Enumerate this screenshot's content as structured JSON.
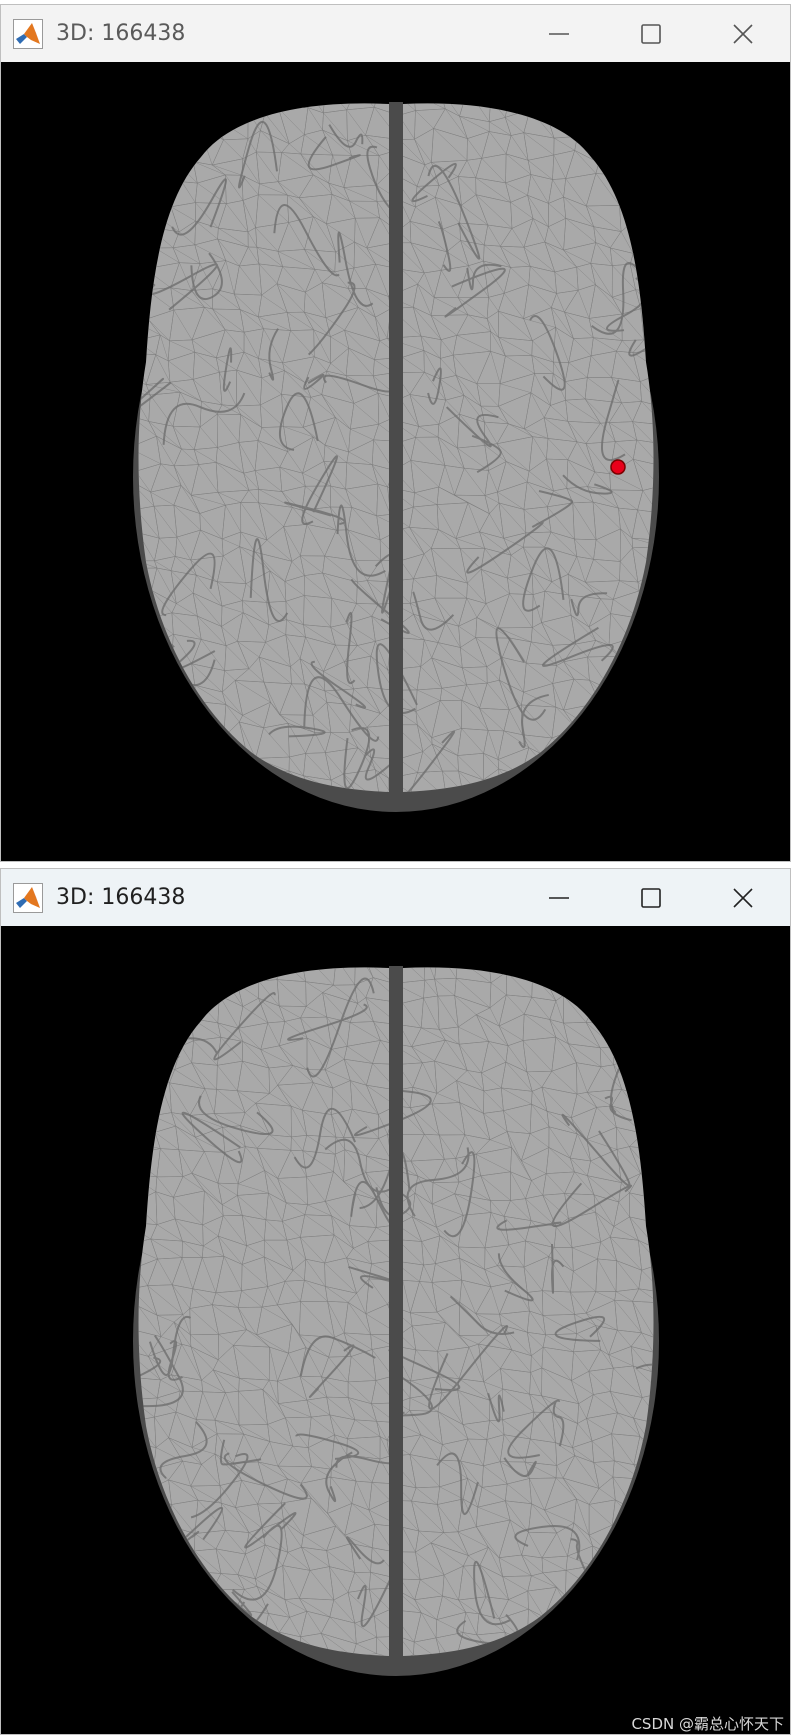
{
  "windows": [
    {
      "title": "3D: 166438",
      "icon": "matlab-icon",
      "controls": [
        "minimize-icon",
        "maximize-icon",
        "close-icon"
      ],
      "has_marker": true,
      "marker_color": "#e8001a"
    },
    {
      "title": "3D: 166438",
      "icon": "matlab-icon",
      "controls": [
        "minimize-icon",
        "maximize-icon",
        "close-icon"
      ],
      "has_marker": false
    }
  ],
  "colors": {
    "brain_fill": "#a9a9a9",
    "skull_fill": "#4b4b4b",
    "mesh_line": "#7b7b7b",
    "background": "#000000"
  },
  "watermark": "CSDN @霸总心怀天下"
}
